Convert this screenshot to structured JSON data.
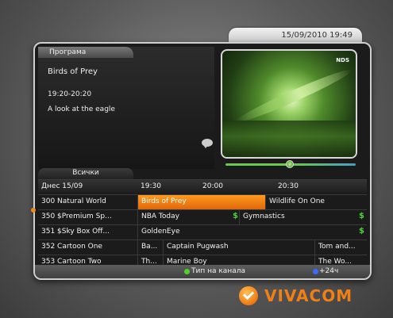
{
  "header": {
    "datetime": "15/09/2010 19:49"
  },
  "info": {
    "tab_label": "Програма",
    "title": "Birds of Prey",
    "time": "19:20-20:20",
    "description": "A look at the eagle"
  },
  "preview": {
    "logo": "NDS",
    "progress_fraction": 0.5
  },
  "guide": {
    "filter_label": "Всички",
    "date_label": "Днес 15/09",
    "times": [
      "19:30",
      "20:00",
      "20:30"
    ],
    "rows": [
      {
        "channel": "300 Natural World",
        "programs": [
          "Birds of Prey",
          "Wildlife On One"
        ]
      },
      {
        "channel": "350 $Premium Sp...",
        "programs": [
          "NBA Today",
          "$",
          "Gymnastics",
          "$"
        ]
      },
      {
        "channel": "351 $Sky Box Off...",
        "programs": [
          "GoldenEye",
          "$"
        ]
      },
      {
        "channel": "352 Cartoon One",
        "programs": [
          "Ba...",
          "Captain Pugwash",
          "Tom and..."
        ]
      },
      {
        "channel": "353 Cartoon Two",
        "programs": [
          "Th...",
          "Marine Boy",
          "The Wo..."
        ]
      }
    ]
  },
  "footer": {
    "green_label": "Тип на канала",
    "blue_label": "+24ч",
    "colors": {
      "green": "#52d12e",
      "blue": "#3b6bff",
      "selection": "#f08a1e"
    }
  },
  "brand": {
    "name": "VIVACOM"
  },
  "icons": [
    "speech-bubble-icon",
    "green-key-icon",
    "blue-key-icon",
    "vivacom-logo-icon"
  ]
}
